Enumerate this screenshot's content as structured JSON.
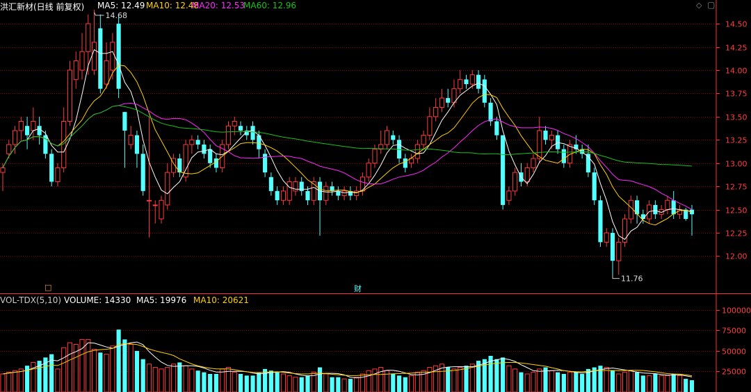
{
  "header": {
    "stock": "洪汇新材(日线 前复权)",
    "ma5": "MA5: 12.49",
    "ma10": "MA10: 12.48",
    "ma20": "MA20: 12.53",
    "ma60": "MA60: 12.96"
  },
  "volume_header": {
    "title": "VOL-TDX(5,10)",
    "volume": "VOLUME: 14330",
    "ma5": "MA5: 19976",
    "ma10": "MA10: 20621"
  },
  "markers": {
    "finance": "财",
    "box": "□"
  },
  "colors": {
    "up": "#ff3b3b",
    "down": "#54ffff",
    "ma5": "#ffffff",
    "ma10": "#ffd200",
    "ma20": "#ff28ff",
    "ma60": "#17c317",
    "grid": "#8b0000",
    "axis": "#ff3030"
  },
  "chart_data": [
    {
      "type": "candlestick",
      "price_axis": {
        "range": [
          11.6,
          14.65
        ],
        "ticks": [
          "14.50",
          "14.25",
          "14.00",
          "13.75",
          "13.50",
          "13.25",
          "13.00",
          "12.75",
          "12.50",
          "12.25",
          "12.00"
        ]
      },
      "annotations": {
        "high": "14.68",
        "low": "11.76"
      },
      "candles": [
        [
          12.9,
          12.95,
          12.7,
          13.0
        ],
        [
          13.1,
          13.2,
          13.05,
          13.25
        ],
        [
          13.2,
          13.35,
          13.1,
          13.4
        ],
        [
          13.35,
          13.45,
          13.25,
          13.5
        ],
        [
          13.4,
          13.3,
          13.15,
          13.5
        ],
        [
          13.35,
          13.45,
          13.25,
          13.6
        ],
        [
          13.4,
          13.3,
          13.2,
          13.5
        ],
        [
          13.3,
          13.1,
          13.05,
          13.35
        ],
        [
          13.1,
          12.8,
          12.75,
          13.15
        ],
        [
          12.8,
          12.95,
          12.75,
          13.0
        ],
        [
          12.95,
          13.45,
          12.9,
          13.6
        ],
        [
          13.45,
          14.0,
          13.4,
          14.1
        ],
        [
          13.9,
          14.1,
          13.8,
          14.2
        ],
        [
          14.0,
          14.2,
          13.9,
          14.4
        ],
        [
          14.2,
          14.5,
          13.95,
          14.6
        ],
        [
          14.0,
          14.3,
          13.95,
          14.65
        ],
        [
          14.45,
          13.8,
          13.75,
          14.6
        ],
        [
          13.85,
          14.1,
          13.8,
          14.3
        ],
        [
          14.0,
          14.3,
          13.9,
          14.4
        ],
        [
          14.5,
          13.8,
          13.7,
          14.6
        ],
        [
          13.55,
          13.35,
          12.95,
          13.55
        ],
        [
          13.2,
          13.3,
          13.15,
          13.4
        ],
        [
          13.3,
          13.1,
          12.95,
          13.35
        ],
        [
          13.1,
          12.7,
          12.65,
          13.2
        ],
        [
          12.6,
          12.6,
          12.2,
          13.5
        ],
        [
          12.55,
          12.55,
          12.35,
          12.6
        ],
        [
          12.4,
          12.6,
          12.35,
          12.65
        ],
        [
          12.55,
          12.9,
          12.5,
          13.0
        ],
        [
          12.9,
          13.05,
          12.85,
          13.1
        ],
        [
          13.05,
          12.9,
          12.85,
          13.1
        ],
        [
          12.85,
          13.2,
          12.8,
          13.25
        ],
        [
          13.2,
          13.25,
          13.1,
          13.3
        ],
        [
          13.25,
          13.2,
          13.15,
          13.3
        ],
        [
          13.2,
          13.1,
          13.05,
          13.25
        ],
        [
          13.15,
          13.0,
          12.95,
          13.2
        ],
        [
          13.05,
          12.95,
          12.9,
          13.1
        ],
        [
          12.95,
          13.2,
          12.9,
          13.25
        ],
        [
          13.2,
          13.4,
          13.15,
          13.45
        ],
        [
          13.4,
          13.45,
          13.3,
          13.5
        ],
        [
          13.4,
          13.35,
          13.3,
          13.45
        ],
        [
          13.35,
          13.3,
          13.25,
          13.4
        ],
        [
          13.4,
          13.25,
          13.2,
          13.45
        ],
        [
          13.3,
          13.15,
          13.05,
          13.35
        ],
        [
          13.1,
          12.9,
          12.85,
          13.15
        ],
        [
          12.85,
          12.7,
          12.65,
          12.9
        ],
        [
          12.7,
          12.6,
          12.55,
          12.75
        ],
        [
          12.6,
          12.7,
          12.55,
          12.75
        ],
        [
          12.6,
          12.8,
          12.55,
          12.85
        ],
        [
          12.7,
          12.8,
          12.65,
          12.85
        ],
        [
          12.8,
          12.7,
          12.65,
          12.85
        ],
        [
          12.7,
          12.6,
          12.55,
          12.75
        ],
        [
          12.6,
          12.8,
          12.55,
          12.85
        ],
        [
          12.8,
          12.6,
          12.22,
          12.85
        ],
        [
          12.6,
          12.75,
          12.55,
          12.8
        ],
        [
          12.75,
          12.7,
          12.65,
          12.8
        ],
        [
          12.7,
          12.65,
          12.6,
          12.75
        ],
        [
          12.65,
          12.7,
          12.6,
          12.75
        ],
        [
          12.7,
          12.65,
          12.6,
          12.75
        ],
        [
          12.65,
          12.7,
          12.6,
          12.75
        ],
        [
          12.7,
          12.85,
          12.65,
          12.9
        ],
        [
          12.85,
          13.0,
          12.8,
          13.05
        ],
        [
          13.0,
          13.15,
          12.95,
          13.2
        ],
        [
          13.15,
          13.2,
          13.1,
          13.35
        ],
        [
          13.2,
          13.35,
          13.15,
          13.4
        ],
        [
          13.3,
          13.25,
          13.2,
          13.35
        ],
        [
          13.25,
          13.05,
          13.0,
          13.3
        ],
        [
          13.05,
          12.95,
          12.9,
          13.1
        ],
        [
          13.0,
          13.05,
          12.95,
          13.1
        ],
        [
          13.05,
          13.2,
          13.0,
          13.25
        ],
        [
          13.2,
          13.3,
          13.15,
          13.35
        ],
        [
          13.3,
          13.5,
          13.25,
          13.6
        ],
        [
          13.5,
          13.6,
          13.45,
          13.7
        ],
        [
          13.6,
          13.7,
          13.55,
          13.8
        ],
        [
          13.7,
          13.65,
          13.6,
          13.8
        ],
        [
          13.65,
          13.8,
          13.6,
          13.9
        ],
        [
          13.8,
          13.9,
          13.75,
          14.0
        ],
        [
          13.9,
          13.85,
          13.8,
          13.95
        ],
        [
          13.85,
          13.95,
          13.8,
          14.0
        ],
        [
          13.95,
          13.8,
          13.75,
          14.0
        ],
        [
          13.9,
          13.65,
          13.6,
          13.95
        ],
        [
          13.65,
          13.45,
          13.4,
          13.7
        ],
        [
          13.45,
          13.3,
          13.25,
          13.5
        ],
        [
          13.3,
          12.55,
          12.5,
          13.3
        ],
        [
          12.6,
          12.7,
          12.55,
          12.75
        ],
        [
          12.7,
          12.9,
          12.65,
          12.95
        ],
        [
          12.9,
          12.8,
          12.75,
          13.0
        ],
        [
          12.8,
          12.95,
          12.75,
          13.0
        ],
        [
          12.95,
          13.05,
          12.9,
          13.1
        ],
        [
          13.05,
          13.35,
          13.0,
          13.5
        ],
        [
          13.35,
          13.25,
          13.2,
          13.4
        ],
        [
          13.25,
          13.3,
          13.15,
          13.35
        ],
        [
          13.3,
          13.15,
          13.1,
          13.35
        ],
        [
          13.15,
          13.0,
          12.95,
          13.2
        ],
        [
          13.0,
          13.2,
          12.95,
          13.25
        ],
        [
          13.2,
          13.15,
          13.1,
          13.3
        ],
        [
          13.15,
          13.1,
          13.05,
          13.2
        ],
        [
          13.1,
          12.9,
          12.85,
          13.2
        ],
        [
          12.9,
          12.6,
          12.55,
          12.95
        ],
        [
          12.6,
          12.15,
          12.1,
          12.65
        ],
        [
          12.15,
          12.25,
          12.1,
          12.3
        ],
        [
          12.25,
          11.95,
          11.76,
          12.3
        ],
        [
          11.95,
          12.15,
          11.8,
          12.2
        ],
        [
          12.15,
          12.4,
          12.1,
          12.45
        ],
        [
          12.4,
          12.6,
          12.35,
          12.65
        ],
        [
          12.6,
          12.45,
          12.35,
          12.65
        ],
        [
          12.45,
          12.4,
          12.35,
          12.5
        ],
        [
          12.4,
          12.55,
          12.35,
          12.6
        ],
        [
          12.55,
          12.45,
          12.4,
          12.6
        ],
        [
          12.45,
          12.5,
          12.4,
          12.55
        ],
        [
          12.5,
          12.6,
          12.45,
          12.65
        ],
        [
          12.6,
          12.45,
          12.4,
          12.7
        ],
        [
          12.45,
          12.5,
          12.4,
          12.55
        ],
        [
          12.5,
          12.4,
          12.38,
          12.52
        ],
        [
          12.5,
          12.45,
          12.22,
          12.55
        ]
      ],
      "series": [
        {
          "name": "MA5",
          "ma_window": 5,
          "last": 12.49
        },
        {
          "name": "MA10",
          "ma_window": 10,
          "last": 12.48
        },
        {
          "name": "MA20",
          "ma_window": 20,
          "last": 12.53
        },
        {
          "name": "MA60",
          "ma_window": 60,
          "last": 12.96
        }
      ]
    },
    {
      "type": "bar",
      "volume_axis": {
        "range": [
          0,
          110000
        ],
        "ticks": [
          "100000",
          "75000",
          "50000",
          "25000"
        ]
      },
      "values": [
        22000,
        24000,
        26000,
        28000,
        32000,
        36000,
        38000,
        42000,
        46000,
        28000,
        54000,
        60000,
        58000,
        64000,
        64000,
        52000,
        48000,
        46000,
        56000,
        76000,
        64000,
        58000,
        50000,
        40000,
        34000,
        30000,
        28000,
        30000,
        34000,
        36000,
        32000,
        28000,
        26000,
        24000,
        22000,
        22000,
        28000,
        30000,
        24000,
        22000,
        20000,
        20000,
        24000,
        28000,
        26000,
        24000,
        22000,
        20000,
        18000,
        18000,
        20000,
        24000,
        30000,
        22000,
        18000,
        18000,
        16000,
        16000,
        18000,
        22000,
        26000,
        28000,
        30000,
        26000,
        22000,
        20000,
        18000,
        20000,
        24000,
        26000,
        30000,
        32000,
        34000,
        30000,
        28000,
        30000,
        32000,
        34000,
        38000,
        40000,
        44000,
        40000,
        42000,
        32000,
        28000,
        24000,
        22000,
        24000,
        28000,
        30000,
        26000,
        24000,
        22000,
        24000,
        24000,
        22000,
        28000,
        30000,
        32000,
        30000,
        26000,
        22000,
        24000,
        26000,
        24000,
        20000,
        20000,
        22000,
        20000,
        20000,
        22000,
        20000,
        16000,
        14330
      ],
      "series": [
        {
          "name": "MA5",
          "last": 19976
        },
        {
          "name": "MA10",
          "last": 20621
        }
      ]
    }
  ]
}
